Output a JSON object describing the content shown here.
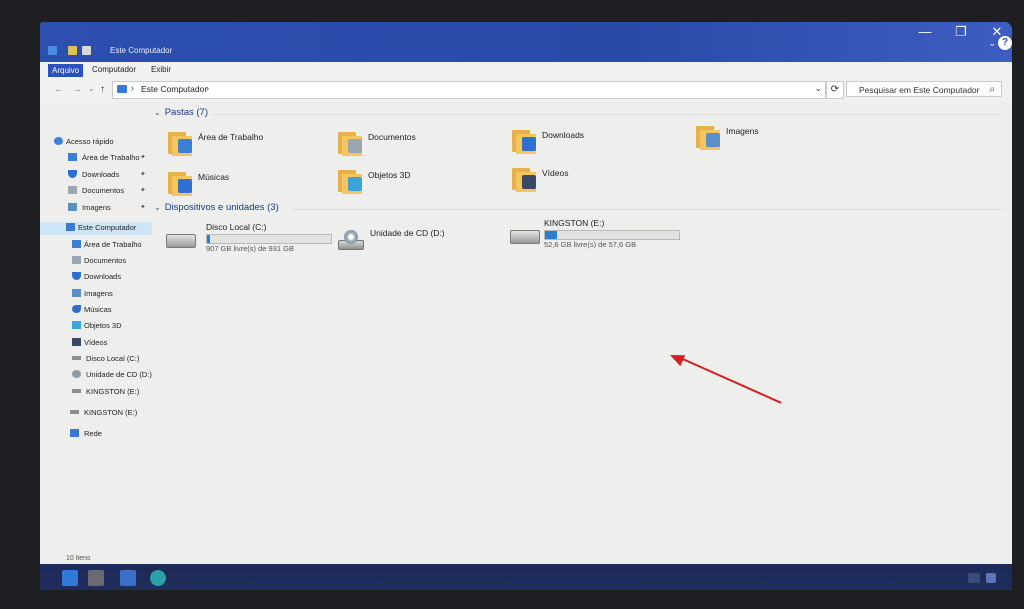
{
  "window": {
    "title": "Este Computador",
    "controls": {
      "minimize": "—",
      "maximize": "❐",
      "close": "✕",
      "expand": "⌄",
      "help": "?"
    }
  },
  "ribbon": {
    "tabs": [
      {
        "label": "Arquivo"
      },
      {
        "label": "Computador"
      },
      {
        "label": "Exibir"
      }
    ]
  },
  "address": {
    "back": "←",
    "forward": "→",
    "recent": "⌄",
    "up": "↑",
    "separator": "›",
    "crumb": "Este Computador",
    "dropdown": "⌄",
    "refresh": "⟳"
  },
  "search": {
    "placeholder": "Pesquisar em Este Computador",
    "icon": "⌕"
  },
  "sidebar": {
    "quick_access": {
      "label": "Acesso rápido",
      "pin_glyph": "✦",
      "items": [
        {
          "label": "Área de Trabalho",
          "icon": "desktop-icon"
        },
        {
          "label": "Downloads",
          "icon": "downloads-icon"
        },
        {
          "label": "Documentos",
          "icon": "documents-icon"
        },
        {
          "label": "Imagens",
          "icon": "pictures-icon"
        }
      ]
    },
    "this_pc": {
      "label": "Este Computador",
      "items": [
        {
          "label": "Área de Trabalho"
        },
        {
          "label": "Documentos"
        },
        {
          "label": "Downloads"
        },
        {
          "label": "Imagens"
        },
        {
          "label": "Músicas"
        },
        {
          "label": "Objetos 3D"
        },
        {
          "label": "Vídeos"
        },
        {
          "label": "Disco Local (C:)"
        },
        {
          "label": "Unidade de CD (D:)"
        },
        {
          "label": "KINGSTON (E:)"
        }
      ]
    },
    "kingston": {
      "label": "KINGSTON (E:)"
    },
    "network": {
      "label": "Rede"
    }
  },
  "content": {
    "chevron": "⌄",
    "folders_header": "Pastas (7)",
    "folders": [
      {
        "label": "Área de Trabalho",
        "glyph_color": "#3c7fd4"
      },
      {
        "label": "Documentos",
        "glyph_color": "#9aa6b2"
      },
      {
        "label": "Downloads",
        "glyph_color": "#2f6fd0"
      },
      {
        "label": "Imagens",
        "glyph_color": "#5a8fc8"
      },
      {
        "label": "Músicas",
        "glyph_color": "#2f6fd0"
      },
      {
        "label": "Objetos 3D",
        "glyph_color": "#3ea3d8"
      },
      {
        "label": "Vídeos",
        "glyph_color": "#3a4a66"
      }
    ],
    "devices_header": "Dispositivos e unidades (3)",
    "devices": [
      {
        "name": "Disco Local (C:)",
        "free": "907 GB livre(s) de 931 GB",
        "used_fraction": 0.026,
        "has_bar": true
      },
      {
        "name": "Unidade de CD (D:)",
        "free": "",
        "used_fraction": 0,
        "has_bar": false
      },
      {
        "name": "KINGSTON (E:)",
        "free": "52,6 GB livre(s) de 57,6 GB",
        "used_fraction": 0.087,
        "has_bar": true
      }
    ]
  },
  "status": {
    "items_count": "10 itens"
  },
  "colors": {
    "accent": "#2b51bf",
    "drive_fill": "#2a7fd4",
    "annotation": "#d62020"
  }
}
